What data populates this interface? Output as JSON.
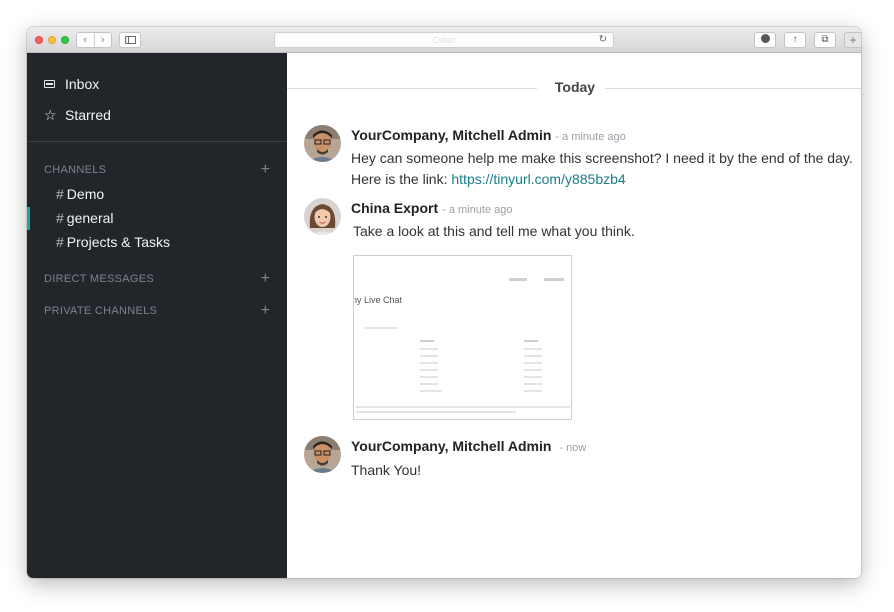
{
  "browser": {
    "url_text": "Odoo",
    "reload_icon": "reload-icon",
    "toolbar_icons": [
      "back-icon",
      "forward-icon",
      "sidebar-icon",
      "download-icon",
      "share-icon",
      "tabs-icon",
      "new-tab-icon"
    ]
  },
  "sidebar": {
    "top_items": [
      {
        "label": "Inbox",
        "icon": "inbox-icon"
      },
      {
        "label": "Starred",
        "icon": "star-icon"
      }
    ],
    "sections": {
      "channels": {
        "label": "CHANNELS",
        "add": "+"
      },
      "direct": {
        "label": "DIRECT MESSAGES",
        "add": "+"
      },
      "private": {
        "label": "PRIVATE CHANNELS",
        "add": "+"
      }
    },
    "channels": [
      {
        "hash": "#",
        "name": "Demo"
      },
      {
        "hash": "#",
        "name": "general",
        "active": true
      },
      {
        "hash": "#",
        "name": "Projects & Tasks"
      }
    ],
    "accent_color": "#19a5a3"
  },
  "thread": {
    "day_separator": "Today",
    "messages": [
      {
        "author": "YourCompany, Mitchell Admin",
        "time": "- a minute ago",
        "line1": "Hey can someone help me make this screenshot? I need it by the end of the day.",
        "line2_prefix": "Here is the link: ",
        "link": "https://tinyurl.com/y885bzb4"
      },
      {
        "author": "China Export",
        "time": "- a minute ago",
        "line1": "Take a look at this and tell me what you think.",
        "attachment_title": "ny Live Chat"
      },
      {
        "author": "YourCompany, Mitchell Admin",
        "time": "- now",
        "line1": "Thank You!"
      }
    ],
    "link_color": "#177e89"
  }
}
